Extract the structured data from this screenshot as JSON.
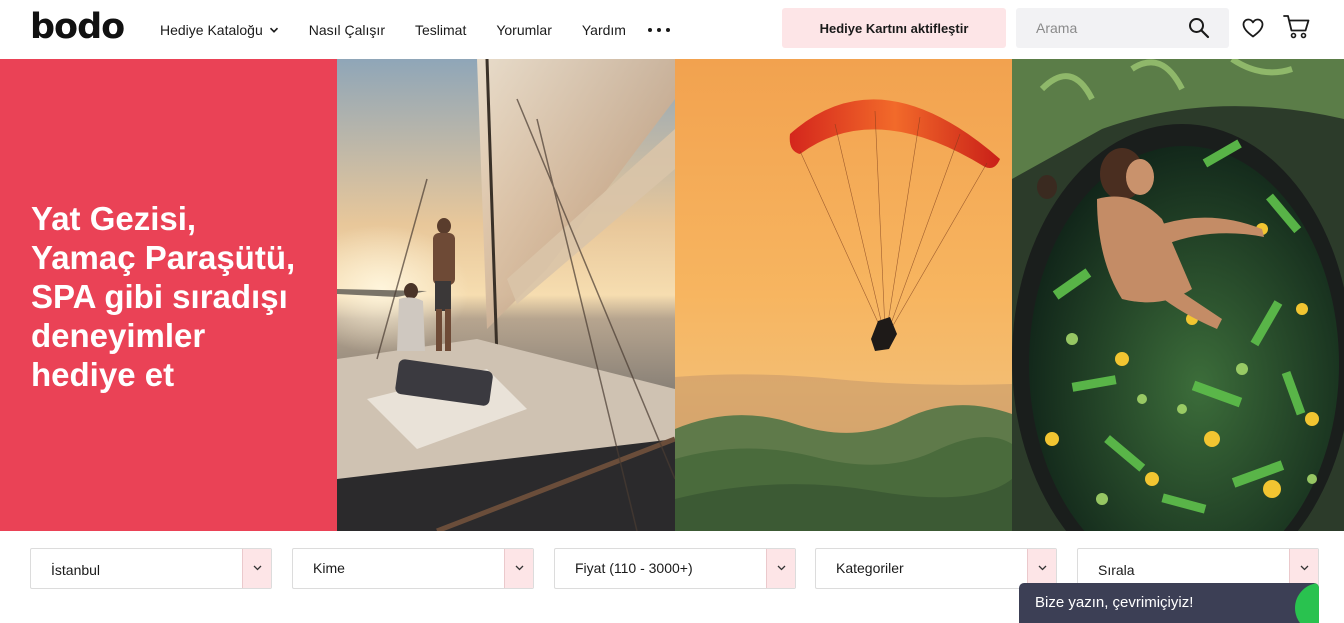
{
  "header": {
    "logo": "bodo",
    "nav": [
      {
        "label": "Hediye Kataloğu",
        "has_dropdown": true
      },
      {
        "label": "Nasıl Çalışır"
      },
      {
        "label": "Teslimat"
      },
      {
        "label": "Yorumlar"
      },
      {
        "label": "Yardım"
      }
    ],
    "more_icon": "ellipsis-icon",
    "activate_label": "Hediye Kartını aktifleştir",
    "search_placeholder": "Arama",
    "icons": [
      "search-icon",
      "heart-icon",
      "cart-icon"
    ]
  },
  "hero": {
    "title_lines": [
      "Yat Gezisi,",
      "Yamaç Paraşütü,",
      "SPA gibi sıradışı",
      "deneyimler",
      "hediye et"
    ],
    "background_color": "#ea4256",
    "panels": [
      "yacht-photo",
      "paragliding-photo",
      "spa-bath-photo"
    ]
  },
  "filters": [
    {
      "label": "İstanbul"
    },
    {
      "label": "Kime"
    },
    {
      "label": "Fiyat (110 - 3000+)"
    },
    {
      "label": "Kategoriler"
    },
    {
      "label": "Sırala"
    }
  ],
  "chat": {
    "label": "Bize yazın, çevrimiçiyiz!",
    "status_color": "#29c24f"
  },
  "colors": {
    "accent": "#ea4256",
    "accent_light": "#fde5e7",
    "chat_bg": "#3c3f55"
  }
}
